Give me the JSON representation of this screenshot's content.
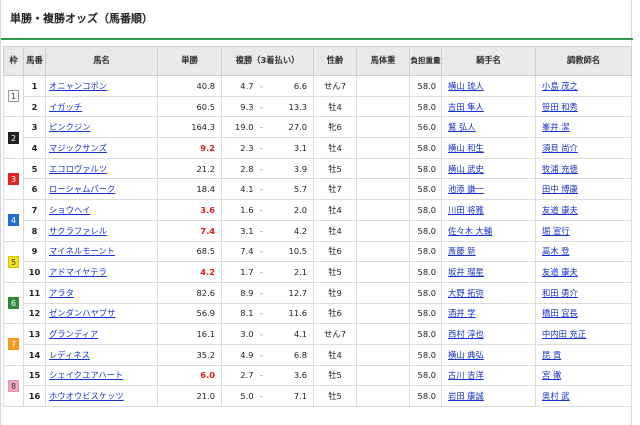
{
  "page": {
    "title": "単勝・複勝オッズ（馬番順）"
  },
  "header": {
    "waku": "枠",
    "umaban": "馬番",
    "horse": "馬名",
    "win": "単勝",
    "place": "複勝（3着払い）",
    "sexage": "性齢",
    "weight": "馬体重",
    "kinryo": "負担重量",
    "jockey": "騎手名",
    "trainer": "調教師名"
  },
  "colors": {
    "accent": "#2d9a52",
    "hot_odds": "#d81b1b",
    "link": "#1a33c8"
  },
  "waku_styles": [
    {
      "bg": "#ffffff",
      "fg": "#333333",
      "border": "#999999"
    },
    {
      "bg": "#222222",
      "fg": "#ffffff",
      "border": "#222222"
    },
    {
      "bg": "#e02424",
      "fg": "#ffffff",
      "border": "#e02424"
    },
    {
      "bg": "#1f6fd1",
      "fg": "#ffffff",
      "border": "#1f6fd1"
    },
    {
      "bg": "#f4e21a",
      "fg": "#333333",
      "border": "#d6c500"
    },
    {
      "bg": "#2e8a3a",
      "fg": "#ffffff",
      "border": "#2e8a3a"
    },
    {
      "bg": "#f39a1c",
      "fg": "#ffffff",
      "border": "#f39a1c"
    },
    {
      "bg": "#f4a8c6",
      "fg": "#333333",
      "border": "#e890b4"
    }
  ],
  "rows": [
    {
      "waku": "1",
      "num": "1",
      "horse": "オニャンコポン",
      "win": "40.8",
      "place_lo": "4.7",
      "place_hi": "6.6",
      "sexage": "せん7",
      "weight": "",
      "kinryo": "58.0",
      "jockey": "横山 琉人",
      "trainer": "小島 茂之",
      "hot": false
    },
    {
      "waku": "",
      "num": "2",
      "horse": "イガッチ",
      "win": "60.5",
      "place_lo": "9.3",
      "place_hi": "13.3",
      "sexage": "牡4",
      "weight": "",
      "kinryo": "58.0",
      "jockey": "吉田 隼人",
      "trainer": "笹田 和秀",
      "hot": false
    },
    {
      "waku": "2",
      "num": "3",
      "horse": "ピンクジン",
      "win": "164.3",
      "place_lo": "19.0",
      "place_hi": "27.0",
      "sexage": "牝6",
      "weight": "",
      "kinryo": "56.0",
      "jockey": "鷲 弘人",
      "trainer": "峯井 潔",
      "hot": false
    },
    {
      "waku": "",
      "num": "4",
      "horse": "マジックサンズ",
      "win": "9.2",
      "place_lo": "2.3",
      "place_hi": "3.1",
      "sexage": "牡4",
      "weight": "",
      "kinryo": "58.0",
      "jockey": "横山 和生",
      "trainer": "須貝 尚介",
      "hot": true
    },
    {
      "waku": "3",
      "num": "5",
      "horse": "エコロヴァルツ",
      "win": "21.2",
      "place_lo": "2.8",
      "place_hi": "3.9",
      "sexage": "牡5",
      "weight": "",
      "kinryo": "58.0",
      "jockey": "横山 武史",
      "trainer": "牧浦 充徳",
      "hot": false
    },
    {
      "waku": "",
      "num": "6",
      "horse": "ローシャムパーク",
      "win": "18.4",
      "place_lo": "4.1",
      "place_hi": "5.7",
      "sexage": "牡7",
      "weight": "",
      "kinryo": "58.0",
      "jockey": "池添 謙一",
      "trainer": "田中 博康",
      "hot": false
    },
    {
      "waku": "4",
      "num": "7",
      "horse": "ショウヘイ",
      "win": "3.6",
      "place_lo": "1.6",
      "place_hi": "2.0",
      "sexage": "牡4",
      "weight": "",
      "kinryo": "58.0",
      "jockey": "川田 将雅",
      "trainer": "友道 康夫",
      "hot": true
    },
    {
      "waku": "",
      "num": "8",
      "horse": "サクラファレル",
      "win": "7.4",
      "place_lo": "3.1",
      "place_hi": "4.2",
      "sexage": "牡4",
      "weight": "",
      "kinryo": "58.0",
      "jockey": "佐々木 大輔",
      "trainer": "堀 宣行",
      "hot": true
    },
    {
      "waku": "5",
      "num": "9",
      "horse": "マイネルモーント",
      "win": "68.5",
      "place_lo": "7.4",
      "place_hi": "10.5",
      "sexage": "牡6",
      "weight": "",
      "kinryo": "58.0",
      "jockey": "斎藤 新",
      "trainer": "高木 登",
      "hot": false
    },
    {
      "waku": "",
      "num": "10",
      "horse": "アドマイヤテラ",
      "win": "4.2",
      "place_lo": "1.7",
      "place_hi": "2.1",
      "sexage": "牡5",
      "weight": "",
      "kinryo": "58.0",
      "jockey": "坂井 瑠星",
      "trainer": "友道 康夫",
      "hot": true
    },
    {
      "waku": "6",
      "num": "11",
      "horse": "アラタ",
      "win": "82.6",
      "place_lo": "8.9",
      "place_hi": "12.7",
      "sexage": "牡9",
      "weight": "",
      "kinryo": "58.0",
      "jockey": "大野 拓弥",
      "trainer": "和田 勇介",
      "hot": false
    },
    {
      "waku": "",
      "num": "12",
      "horse": "ゼンダンハヤブサ",
      "win": "56.9",
      "place_lo": "8.1",
      "place_hi": "11.6",
      "sexage": "牡6",
      "weight": "",
      "kinryo": "58.0",
      "jockey": "酒井 学",
      "trainer": "橋田 宜長",
      "hot": false
    },
    {
      "waku": "7",
      "num": "13",
      "horse": "グランディア",
      "win": "16.1",
      "place_lo": "3.0",
      "place_hi": "4.1",
      "sexage": "せん7",
      "weight": "",
      "kinryo": "58.0",
      "jockey": "西村 淳也",
      "trainer": "中内田 充正",
      "hot": false
    },
    {
      "waku": "",
      "num": "14",
      "horse": "レディネス",
      "win": "35.2",
      "place_lo": "4.9",
      "place_hi": "6.8",
      "sexage": "牡4",
      "weight": "",
      "kinryo": "58.0",
      "jockey": "横山 典弘",
      "trainer": "昆 貢",
      "hot": false
    },
    {
      "waku": "8",
      "num": "15",
      "horse": "シェイクユアハート",
      "win": "6.0",
      "place_lo": "2.7",
      "place_hi": "3.6",
      "sexage": "牡5",
      "weight": "",
      "kinryo": "58.0",
      "jockey": "古川 吉洋",
      "trainer": "宮 徹",
      "hot": true
    },
    {
      "waku": "",
      "num": "16",
      "horse": "ホウオウビスケッツ",
      "win": "21.0",
      "place_lo": "5.0",
      "place_hi": "7.1",
      "sexage": "牡5",
      "weight": "",
      "kinryo": "58.0",
      "jockey": "岩田 康誠",
      "trainer": "奥村 武",
      "hot": false
    }
  ]
}
